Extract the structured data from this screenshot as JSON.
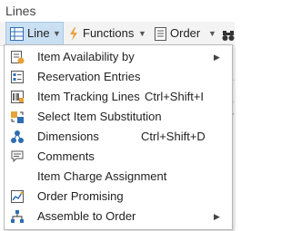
{
  "window": {
    "title": "Lines"
  },
  "toolbar": {
    "line_label": "Line",
    "functions_label": "Functions",
    "order_label": "Order"
  },
  "menu": {
    "items": [
      {
        "label": "Item Availability by",
        "shortcut": "",
        "has_submenu": true,
        "icon": "availability-icon"
      },
      {
        "label": "Reservation Entries",
        "shortcut": "",
        "has_submenu": false,
        "icon": "reservation-entries-icon"
      },
      {
        "label": "Item Tracking Lines",
        "shortcut": "Ctrl+Shift+I",
        "has_submenu": false,
        "icon": "item-tracking-icon"
      },
      {
        "label": "Select Item Substitution",
        "shortcut": "",
        "has_submenu": false,
        "icon": "substitution-icon"
      },
      {
        "label": "Dimensions",
        "shortcut": "Ctrl+Shift+D",
        "has_submenu": false,
        "icon": "dimensions-icon"
      },
      {
        "label": "Comments",
        "shortcut": "",
        "has_submenu": false,
        "icon": "comments-icon"
      },
      {
        "label": "Item Charge Assignment",
        "shortcut": "",
        "has_submenu": false,
        "icon": ""
      },
      {
        "label": "Order Promising",
        "shortcut": "",
        "has_submenu": false,
        "icon": "order-promising-icon"
      },
      {
        "label": "Assemble to Order",
        "shortcut": "",
        "has_submenu": true,
        "icon": "assemble-to-order-icon"
      }
    ]
  },
  "colors": {
    "accent": "#c9dff2",
    "icon_blue": "#2e6db4",
    "icon_orange": "#e8a23a"
  }
}
